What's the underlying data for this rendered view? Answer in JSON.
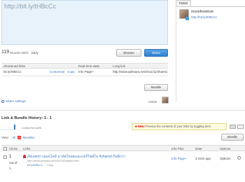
{
  "composer": {
    "url_text": "http://bit.ly/tHBcCc",
    "char_count": "119",
    "shorten_with_label": "Shorten With:",
    "shortener_value": "bit.ly",
    "shorten_label": "Shorten",
    "share_label": "Share"
  },
  "links_table": {
    "headers": [
      "Shortened links",
      "Real-time stats",
      "Long link"
    ],
    "row": {
      "short": "bit.ly/tHBcCc",
      "customize": "Customize",
      "separator": "|",
      "copy": "Copy",
      "stats": "Info Page+",
      "long": "http://www.aphsara.net/2011/11/shared/"
    },
    "bundle_label": "Bundle"
  },
  "twitter": {
    "tab_label": "Twitter",
    "username": "morefreelove",
    "link": "http://bit.ly/tHBcCc"
  },
  "settings": {
    "share_settings_label": "Share settings",
    "active_label": "Active"
  },
  "history": {
    "title": "Link & Bundle History: 1 - 1",
    "clicks_week": "1 clicks this week",
    "notice_new": "New!",
    "notice_text": "Preview the contents of your links by toggling here",
    "view_label": "View:",
    "view_all": "All",
    "view_count": "0",
    "view_bundles": "Bundles",
    "bundle_label": "Bundle",
    "columns": [
      "Clicks",
      "Links",
      "Info Plus",
      "Date",
      "Options"
    ],
    "rows": [
      {
        "clicks": "1",
        "out_of": "out of",
        "total": "1",
        "title": "อัปเดตข่าวออนไลน์ มาอัพโหลดและแชร์ไฟล์ใน 4shared กันดีกว่า",
        "long": "http://www.aphsara.net/2011/11/shared.html",
        "short": "bit.ly/tHBcCc",
        "copy": "Copy",
        "info": "Info Page+",
        "date": "2 mins ago",
        "options": "Options"
      }
    ]
  },
  "colors": {
    "accent": "#3a78c2",
    "share_button": "#2f7fd0",
    "notice_bg": "#fffbe0"
  }
}
